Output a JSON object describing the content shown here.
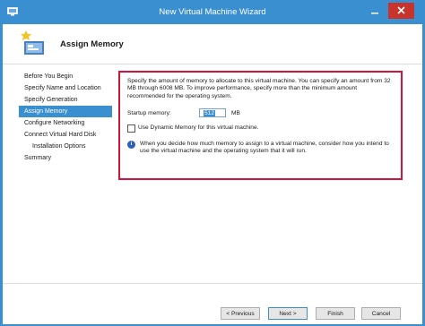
{
  "window": {
    "title": "New Virtual Machine Wizard",
    "accent_color": "#3a8fd0",
    "close_color": "#c8332b",
    "icons": {
      "app": "hyper-v-icon",
      "minimize": "minimize-icon",
      "close": "close-icon"
    }
  },
  "header": {
    "title": "Assign Memory",
    "icon": "memory-wizard-icon"
  },
  "nav": {
    "items": [
      {
        "label": "Before You Begin",
        "active": false
      },
      {
        "label": "Specify Name and Location",
        "active": false
      },
      {
        "label": "Specify Generation",
        "active": false
      },
      {
        "label": "Assign Memory",
        "active": true
      },
      {
        "label": "Configure Networking",
        "active": false
      },
      {
        "label": "Connect Virtual Hard Disk",
        "active": false
      },
      {
        "label": "Installation Options",
        "active": false
      },
      {
        "label": "Summary",
        "active": false
      }
    ]
  },
  "content": {
    "description": "Specify the amount of memory to allocate to this virtual machine. You can specify an amount from 32 MB through 6008 MB. To improve performance, specify more than the minimum amount recommended for the operating system.",
    "startup_label": "Startup memory:",
    "startup_value": "512",
    "startup_unit": "MB",
    "dynamic_memory_label": "Use Dynamic Memory for this virtual machine.",
    "dynamic_memory_checked": false,
    "info_icon": "info-icon",
    "info_text": "When you decide how much memory to assign to a virtual machine, consider how you intend to use the virtual machine and the operating system that it will run.",
    "highlight_color": "#d2143a"
  },
  "buttons": {
    "previous": "< Previous",
    "next": "Next >",
    "finish": "Finish",
    "cancel": "Cancel"
  }
}
